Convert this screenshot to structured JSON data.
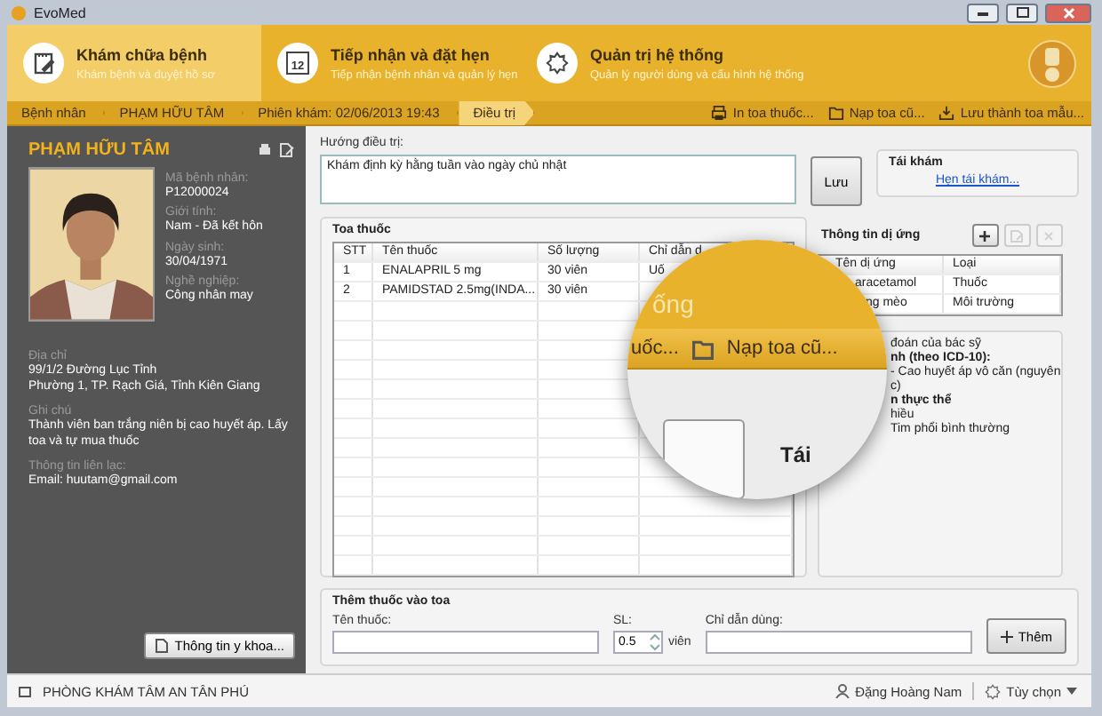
{
  "window": {
    "title": "EvoMed"
  },
  "modules": [
    {
      "kind": "notes",
      "label": "Khám chữa bệnh",
      "subtitle": "Khám bệnh và duyệt hồ sơ",
      "selected": true
    },
    {
      "kind": "calendar",
      "icon_text": "12",
      "label": "Tiếp nhận và đặt hẹn",
      "subtitle": "Tiếp nhận bệnh nhân và quản lý hẹn",
      "selected": false
    },
    {
      "kind": "gear",
      "label": "Quản trị hệ thống",
      "subtitle": "Quản lý người dùng và cấu hình hệ thống",
      "selected": false
    }
  ],
  "breadcrumb": [
    {
      "label": "Bệnh nhân",
      "selected": false
    },
    {
      "label": "PHẠM HỮU TÂM",
      "selected": false
    },
    {
      "label": "Phiên khám: 02/06/2013 19:43",
      "selected": false
    },
    {
      "label": "Điều trị",
      "selected": true
    }
  ],
  "toolbar_actions": [
    {
      "kind": "print",
      "label": "In toa thuốc..."
    },
    {
      "kind": "folder",
      "label": "Nạp toa cũ..."
    },
    {
      "kind": "download",
      "label": "Lưu thành toa mẫu..."
    }
  ],
  "patient": {
    "name": "PHẠM HỮU TÂM",
    "fields": [
      {
        "label": "Mã bệnh nhân:",
        "value": "P12000024"
      },
      {
        "label": "Giới tính:",
        "value": "Nam - Đã kết hôn"
      },
      {
        "label": "Ngày sinh:",
        "value": "30/04/1971"
      },
      {
        "label": "Nghề nghiệp:",
        "value": "Công nhân may"
      }
    ],
    "details": [
      {
        "label": "Địa chỉ",
        "value": "99/1/2 Đường Lục Tỉnh\nPhường 1, TP. Rạch Giá, Tỉnh Kiên Giang"
      },
      {
        "label": "Ghi chú",
        "value": "Thành viên ban trắng niên bị cao huyết áp. Lấy toa và tự mua thuốc"
      },
      {
        "label": "Thông tin liên lạc:",
        "value": "Email: huutam@gmail.com"
      }
    ],
    "medical_button": "Thông tin y khoa..."
  },
  "treatment": {
    "label": "Hướng điều trị:",
    "value": "Khám định kỳ hằng tuần vào ngày chủ nhật",
    "save_button": "Lưu"
  },
  "follow_up": {
    "title": "Tái khám",
    "link": "Hẹn tái khám..."
  },
  "prescription": {
    "title": "Toa thuốc",
    "columns": [
      "STT",
      "Tên thuốc",
      "Số lượng",
      "Chỉ dẫn d"
    ],
    "rows": [
      [
        "1",
        "ENALAPRIL 5 mg",
        "30 viên",
        "Uố"
      ],
      [
        "2",
        "PAMIDSTAD 2.5mg(INDA...",
        "30 viên",
        ""
      ]
    ]
  },
  "allergies": {
    "title": "Thông tin dị ứng",
    "buttons": [
      {
        "kind": "add",
        "disabled": false
      },
      {
        "kind": "edit",
        "disabled": true
      },
      {
        "kind": "delete",
        "disabled": true
      }
    ],
    "columns": [
      "Tên dị ứng",
      "Loại"
    ],
    "rows": [
      [
        "aracetamol",
        "Thuốc"
      ],
      [
        "ng mèo",
        "Môi trường"
      ]
    ]
  },
  "diagnosis": {
    "title": "đoán của bác sỹ",
    "lines": [
      {
        "text": "nh (theo ICD-10):",
        "bold": true
      },
      {
        "text": "- Cao huyết áp vô căn (nguyên",
        "bold": false
      },
      {
        "text": "c)",
        "bold": false
      },
      {
        "text": "n thực thể",
        "bold": true
      },
      {
        "text": "hiều",
        "bold": false
      },
      {
        "text": "Tim phổi bình thường",
        "bold": false
      }
    ]
  },
  "add_drug": {
    "title": "Thêm thuốc vào toa",
    "name_label": "Tên thuốc:",
    "qty_label": "SL:",
    "qty_value": "0.5",
    "unit": "viên",
    "usage_label": "Chỉ dẫn dùng:",
    "add_button": "Thêm"
  },
  "status_bar": {
    "clinic": "PHÒNG KHÁM TÂM AN TÂN PHÚ",
    "user": "Đặng Hoàng Nam",
    "options": "Tùy chọn"
  },
  "magnifier": {
    "header_text": "ống",
    "toolbar_texts": [
      "uốc...",
      "Nạp toa cũ..."
    ],
    "panel_text": "Tái"
  }
}
